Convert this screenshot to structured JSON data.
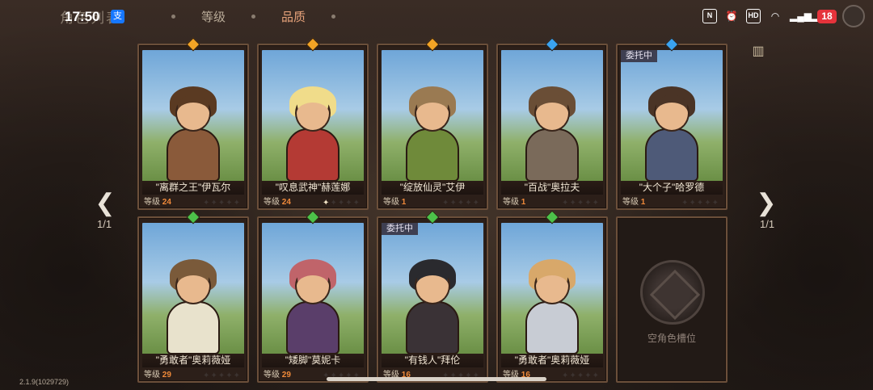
{
  "status_bar": {
    "time": "17:50",
    "pay_badge": "支",
    "battery": "18",
    "icons": [
      "nfc-icon",
      "alarm-icon",
      "hd-icon",
      "wifi-icon",
      "signal-5g-icon",
      "signal-icon"
    ]
  },
  "header": {
    "title": "角色列表",
    "filters": [
      "等级",
      "品质"
    ],
    "active_filter": "品质"
  },
  "pager": {
    "left": "1/1",
    "right": "1/1"
  },
  "cards": [
    {
      "name": "\"离群之王\"伊瓦尔",
      "level_label": "等级",
      "level": "24",
      "gem_color": "#f3a425",
      "stars_on": 0,
      "tag": "",
      "hair": "#5a3a22",
      "outfit": "#8a5a3a"
    },
    {
      "name": "\"叹息武神\"赫莲娜",
      "level_label": "等级",
      "level": "24",
      "gem_color": "#f3a425",
      "stars_on": 1,
      "tag": "",
      "hair": "#f0dc8a",
      "outfit": "#b43a34"
    },
    {
      "name": "\"绽放仙灵\"艾伊",
      "level_label": "等级",
      "level": "1",
      "gem_color": "#f3a425",
      "stars_on": 0,
      "tag": "",
      "hair": "#9a7a52",
      "outfit": "#6f8a3a"
    },
    {
      "name": "\"百战\"奥拉夫",
      "level_label": "等级",
      "level": "1",
      "gem_color": "#3aa3f0",
      "stars_on": 0,
      "tag": "",
      "hair": "#6a4e36",
      "outfit": "#7a6a5a"
    },
    {
      "name": "\"大个子\"哈罗德",
      "level_label": "等级",
      "level": "1",
      "gem_color": "#3aa3f0",
      "stars_on": 0,
      "tag": "委托中",
      "hair": "#4a3426",
      "outfit": "#4e5a78"
    },
    {
      "name": "\"勇敢者\"奥莉薇娅",
      "level_label": "等级",
      "level": "29",
      "gem_color": "#4cc24a",
      "stars_on": 0,
      "tag": "",
      "hair": "#7a5a3a",
      "outfit": "#e8e2cc"
    },
    {
      "name": "\"矮脚\"莫妮卡",
      "level_label": "等级",
      "level": "29",
      "gem_color": "#4cc24a",
      "stars_on": 0,
      "tag": "",
      "hair": "#c0646a",
      "outfit": "#5a3e6a"
    },
    {
      "name": "\"有钱人\"拜伦",
      "level_label": "等级",
      "level": "16",
      "gem_color": "#4cc24a",
      "stars_on": 0,
      "tag": "委托中",
      "hair": "#2a2a2e",
      "outfit": "#3a3236"
    },
    {
      "name": "\"勇敢者\"奥莉薇娅",
      "level_label": "等级",
      "level": "16",
      "gem_color": "#4cc24a",
      "stars_on": 0,
      "tag": "",
      "hair": "#d8a86a",
      "outfit": "#c8ccd4"
    }
  ],
  "empty_slot": {
    "label": "空角色槽位"
  },
  "footer": {
    "version": "2.1.9(1029729)"
  }
}
